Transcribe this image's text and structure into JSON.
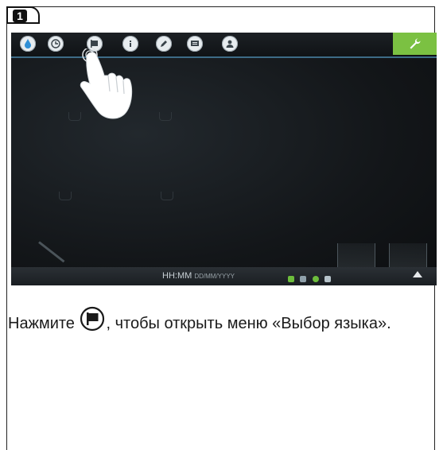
{
  "step": {
    "number": "1"
  },
  "device": {
    "topbar_icons": [
      "water-drop-icon",
      "clock-icon",
      "language-flag-icon",
      "info-icon",
      "pencil-icon",
      "display-icon",
      "user-icon"
    ],
    "settings_icon": "wrench-icon",
    "colors": {
      "accent_green": "#7bc142",
      "topbar_line": "#3d6b86",
      "screen_bg": "#121518"
    },
    "status_bar": {
      "time": "HH:MM",
      "date": "DD/MM/YYYY"
    }
  },
  "instruction": {
    "before": "Нажмите ",
    "icon": "language-flag-icon",
    "after": ", чтобы открыть меню «Выбор языка»."
  }
}
